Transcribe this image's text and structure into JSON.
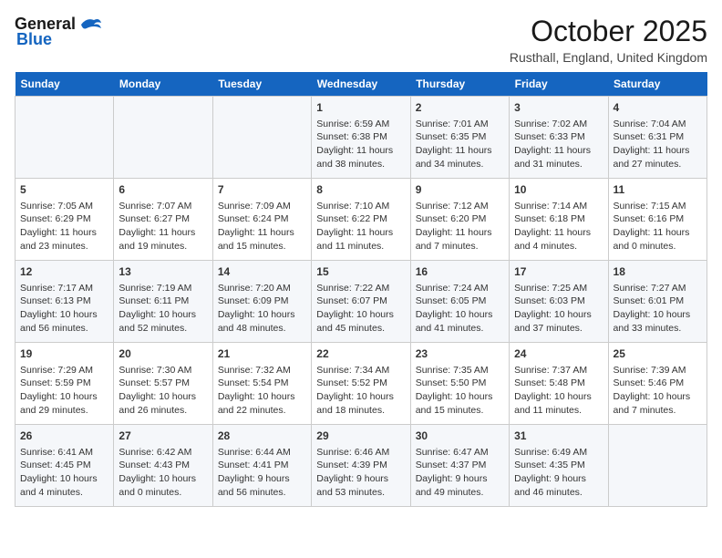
{
  "logo": {
    "line1": "General",
    "line2": "Blue"
  },
  "title": "October 2025",
  "subtitle": "Rusthall, England, United Kingdom",
  "weekdays": [
    "Sunday",
    "Monday",
    "Tuesday",
    "Wednesday",
    "Thursday",
    "Friday",
    "Saturday"
  ],
  "weeks": [
    [
      {
        "day": "",
        "info": ""
      },
      {
        "day": "",
        "info": ""
      },
      {
        "day": "",
        "info": ""
      },
      {
        "day": "1",
        "info": "Sunrise: 6:59 AM\nSunset: 6:38 PM\nDaylight: 11 hours\nand 38 minutes."
      },
      {
        "day": "2",
        "info": "Sunrise: 7:01 AM\nSunset: 6:35 PM\nDaylight: 11 hours\nand 34 minutes."
      },
      {
        "day": "3",
        "info": "Sunrise: 7:02 AM\nSunset: 6:33 PM\nDaylight: 11 hours\nand 31 minutes."
      },
      {
        "day": "4",
        "info": "Sunrise: 7:04 AM\nSunset: 6:31 PM\nDaylight: 11 hours\nand 27 minutes."
      }
    ],
    [
      {
        "day": "5",
        "info": "Sunrise: 7:05 AM\nSunset: 6:29 PM\nDaylight: 11 hours\nand 23 minutes."
      },
      {
        "day": "6",
        "info": "Sunrise: 7:07 AM\nSunset: 6:27 PM\nDaylight: 11 hours\nand 19 minutes."
      },
      {
        "day": "7",
        "info": "Sunrise: 7:09 AM\nSunset: 6:24 PM\nDaylight: 11 hours\nand 15 minutes."
      },
      {
        "day": "8",
        "info": "Sunrise: 7:10 AM\nSunset: 6:22 PM\nDaylight: 11 hours\nand 11 minutes."
      },
      {
        "day": "9",
        "info": "Sunrise: 7:12 AM\nSunset: 6:20 PM\nDaylight: 11 hours\nand 7 minutes."
      },
      {
        "day": "10",
        "info": "Sunrise: 7:14 AM\nSunset: 6:18 PM\nDaylight: 11 hours\nand 4 minutes."
      },
      {
        "day": "11",
        "info": "Sunrise: 7:15 AM\nSunset: 6:16 PM\nDaylight: 11 hours\nand 0 minutes."
      }
    ],
    [
      {
        "day": "12",
        "info": "Sunrise: 7:17 AM\nSunset: 6:13 PM\nDaylight: 10 hours\nand 56 minutes."
      },
      {
        "day": "13",
        "info": "Sunrise: 7:19 AM\nSunset: 6:11 PM\nDaylight: 10 hours\nand 52 minutes."
      },
      {
        "day": "14",
        "info": "Sunrise: 7:20 AM\nSunset: 6:09 PM\nDaylight: 10 hours\nand 48 minutes."
      },
      {
        "day": "15",
        "info": "Sunrise: 7:22 AM\nSunset: 6:07 PM\nDaylight: 10 hours\nand 45 minutes."
      },
      {
        "day": "16",
        "info": "Sunrise: 7:24 AM\nSunset: 6:05 PM\nDaylight: 10 hours\nand 41 minutes."
      },
      {
        "day": "17",
        "info": "Sunrise: 7:25 AM\nSunset: 6:03 PM\nDaylight: 10 hours\nand 37 minutes."
      },
      {
        "day": "18",
        "info": "Sunrise: 7:27 AM\nSunset: 6:01 PM\nDaylight: 10 hours\nand 33 minutes."
      }
    ],
    [
      {
        "day": "19",
        "info": "Sunrise: 7:29 AM\nSunset: 5:59 PM\nDaylight: 10 hours\nand 29 minutes."
      },
      {
        "day": "20",
        "info": "Sunrise: 7:30 AM\nSunset: 5:57 PM\nDaylight: 10 hours\nand 26 minutes."
      },
      {
        "day": "21",
        "info": "Sunrise: 7:32 AM\nSunset: 5:54 PM\nDaylight: 10 hours\nand 22 minutes."
      },
      {
        "day": "22",
        "info": "Sunrise: 7:34 AM\nSunset: 5:52 PM\nDaylight: 10 hours\nand 18 minutes."
      },
      {
        "day": "23",
        "info": "Sunrise: 7:35 AM\nSunset: 5:50 PM\nDaylight: 10 hours\nand 15 minutes."
      },
      {
        "day": "24",
        "info": "Sunrise: 7:37 AM\nSunset: 5:48 PM\nDaylight: 10 hours\nand 11 minutes."
      },
      {
        "day": "25",
        "info": "Sunrise: 7:39 AM\nSunset: 5:46 PM\nDaylight: 10 hours\nand 7 minutes."
      }
    ],
    [
      {
        "day": "26",
        "info": "Sunrise: 6:41 AM\nSunset: 4:45 PM\nDaylight: 10 hours\nand 4 minutes."
      },
      {
        "day": "27",
        "info": "Sunrise: 6:42 AM\nSunset: 4:43 PM\nDaylight: 10 hours\nand 0 minutes."
      },
      {
        "day": "28",
        "info": "Sunrise: 6:44 AM\nSunset: 4:41 PM\nDaylight: 9 hours\nand 56 minutes."
      },
      {
        "day": "29",
        "info": "Sunrise: 6:46 AM\nSunset: 4:39 PM\nDaylight: 9 hours\nand 53 minutes."
      },
      {
        "day": "30",
        "info": "Sunrise: 6:47 AM\nSunset: 4:37 PM\nDaylight: 9 hours\nand 49 minutes."
      },
      {
        "day": "31",
        "info": "Sunrise: 6:49 AM\nSunset: 4:35 PM\nDaylight: 9 hours\nand 46 minutes."
      },
      {
        "day": "",
        "info": ""
      }
    ]
  ]
}
